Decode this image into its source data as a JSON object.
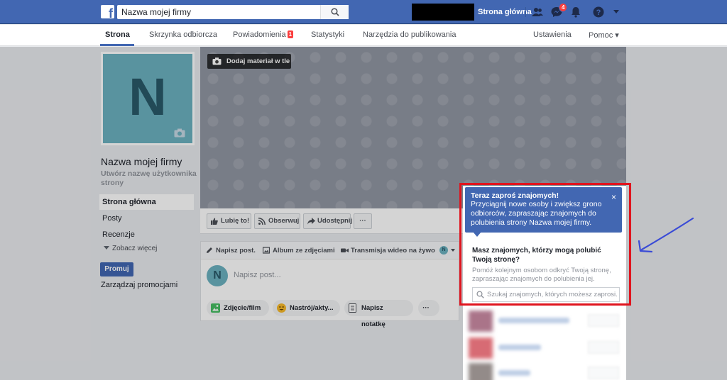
{
  "topbar": {
    "search_value": "Nazwa mojej firmy",
    "home_label": "Strona główna",
    "messages_badge": "4"
  },
  "pagenav": {
    "tabs": [
      {
        "label": "Strona"
      },
      {
        "label": "Skrzynka odbiorcza"
      },
      {
        "label": "Powiadomienia",
        "badge": "1"
      },
      {
        "label": "Statystyki"
      },
      {
        "label": "Narzędzia do publikowania"
      }
    ],
    "settings_label": "Ustawienia",
    "help_label": "Pomoc ▾"
  },
  "profile": {
    "initial": "N",
    "page_name": "Nazwa mojej firmy",
    "username_prompt": "Utwórz nazwę użytkownika strony"
  },
  "leftnav": {
    "items": [
      {
        "label": "Strona główna"
      },
      {
        "label": "Posty"
      },
      {
        "label": "Recenzje"
      }
    ],
    "see_more": "Zobacz więcej",
    "promote_label": "Promuj",
    "manage_promotions": "Zarządzaj promocjami"
  },
  "cover": {
    "add_cover_label": "Dodaj materiał w tle"
  },
  "actions": {
    "like": "Lubię to!",
    "follow": "Obserwuj",
    "share": "Udostępnij",
    "more": "···"
  },
  "composer": {
    "tabs": [
      "Napisz post.",
      "Album ze zdjęciami",
      "Transmisja wideo na żywo"
    ],
    "avatar_initial": "N",
    "placeholder": "Napisz post...",
    "buttons": [
      "Zdjęcie/film",
      "Nastrój/akty...",
      "Napisz notatkę"
    ],
    "more": "···"
  },
  "invite": {
    "tip_title": "Teraz zaproś znajomych!",
    "tip_text": "Przyciągnij nowe osoby i zwiększ grono odbiorców, zapraszając znajomych do polubienia strony Nazwa mojej firmy.",
    "close": "×",
    "question": "Masz znajomych, którzy mogą polubić Twoją stronę?",
    "description": "Pomóż kolejnym osobom odkryć Twoją stronę, zapraszając znajomych do polubienia jej.",
    "search_placeholder": "Szukaj znajomych, których możesz zaprosi..."
  },
  "colors": {
    "brand_blue": "#4267b2",
    "highlight_red": "#e0141e",
    "annotation_blue": "#3a4bd6"
  }
}
